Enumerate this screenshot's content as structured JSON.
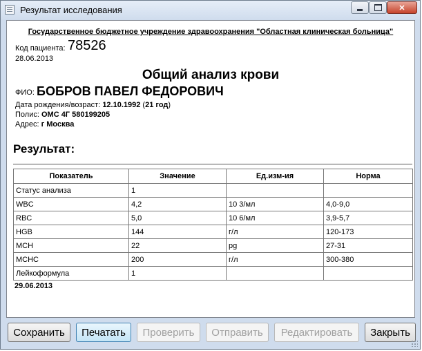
{
  "window": {
    "title": "Результат исследования",
    "close_glyph": "✕"
  },
  "report": {
    "institution": "Государственное бюджетное учреждение здравоохранения \"Областная клиническая больница\"",
    "patient_code_label": "Код пациента:",
    "patient_code": "78526",
    "date": "28.06.2013",
    "analysis_title": "Общий анализ крови",
    "fio_label": "ФИО:",
    "fio": "БОБРОВ ПАВЕЛ ФЕДОРОВИЧ",
    "birth_label": "Дата рождения/возраст:",
    "birth_date": "12.10.1992",
    "age_open": " (",
    "age": "21 год",
    "age_close": ")",
    "policy_label": "Полис:",
    "policy": "ОМС  4Г 580199205",
    "address_label": "Адрес:",
    "address": "г Москва",
    "result_heading": "Результат:",
    "result_date": "29.06.2013"
  },
  "table": {
    "headers": [
      "Показатель",
      "Значение",
      "Ед.изм-ия",
      "Норма"
    ],
    "rows": [
      [
        "Статус анализа",
        "1",
        "",
        ""
      ],
      [
        "WBC",
        "4,2",
        "10 3/мл",
        "4,0-9,0"
      ],
      [
        "RBC",
        "5,0",
        "10 6/мл",
        "3,9-5,7"
      ],
      [
        "HGB",
        "144",
        "г/л",
        "120-173"
      ],
      [
        "MCH",
        "22",
        "pg",
        "27-31"
      ],
      [
        "MCHC",
        "200",
        "г/л",
        "300-380"
      ],
      [
        "Лейкоформула",
        "1",
        "",
        ""
      ]
    ]
  },
  "buttons": {
    "save": "Сохранить",
    "print": "Печатать",
    "check": "Проверить",
    "send": "Отправить",
    "edit": "Редактировать",
    "close": "Закрыть"
  },
  "colors": {
    "window_frame": "#cfdced",
    "close_button": "#c6442c",
    "disabled_text": "#a0a0a0"
  },
  "icons": {
    "app": "document-icon",
    "minimize": "minimize-icon",
    "maximize": "maximize-icon",
    "close": "close-icon"
  }
}
